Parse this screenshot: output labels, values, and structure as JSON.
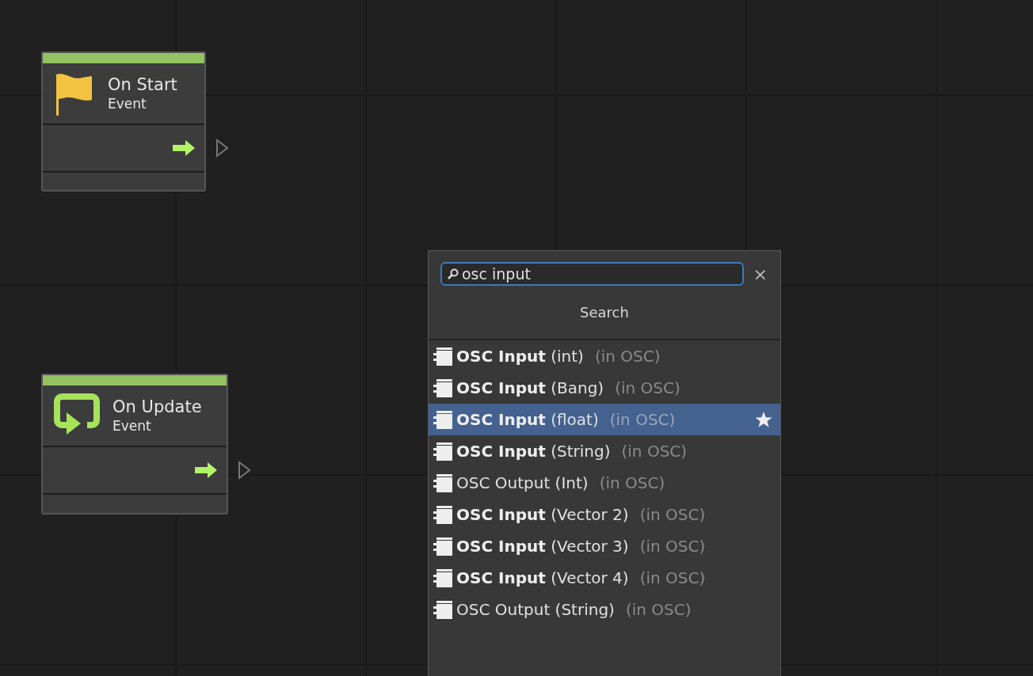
{
  "nodes": [
    {
      "kind": "start",
      "title": "On Start",
      "subtitle": "Event"
    },
    {
      "kind": "update",
      "title": "On Update",
      "subtitle": "Event"
    }
  ],
  "search_popup": {
    "query": "osc input",
    "header": "Search",
    "close": "×",
    "results": [
      {
        "title": "**OSC Input** (int)",
        "category": "(in OSC)",
        "selected": false,
        "starred": false
      },
      {
        "title": "**OSC Input** (Bang)",
        "category": "(in OSC)",
        "selected": false,
        "starred": false
      },
      {
        "title": "**OSC Input** (float)",
        "category": "(in OSC)",
        "selected": true,
        "starred": true
      },
      {
        "title": "**OSC Input** (String)",
        "category": "(in OSC)",
        "selected": false,
        "starred": false
      },
      {
        "title": "OSC Output (Int)",
        "category": "(in OSC)",
        "selected": false,
        "starred": false
      },
      {
        "title": "**OSC Input** (Vector 2)",
        "category": "(in OSC)",
        "selected": false,
        "starred": false
      },
      {
        "title": "**OSC Input** (Vector 3)",
        "category": "(in OSC)",
        "selected": false,
        "starred": false
      },
      {
        "title": "**OSC Input** (Vector 4)",
        "category": "(in OSC)",
        "selected": false,
        "starred": false
      },
      {
        "title": "OSC Output (String)",
        "category": "(in OSC)",
        "selected": false,
        "starred": false
      }
    ]
  }
}
